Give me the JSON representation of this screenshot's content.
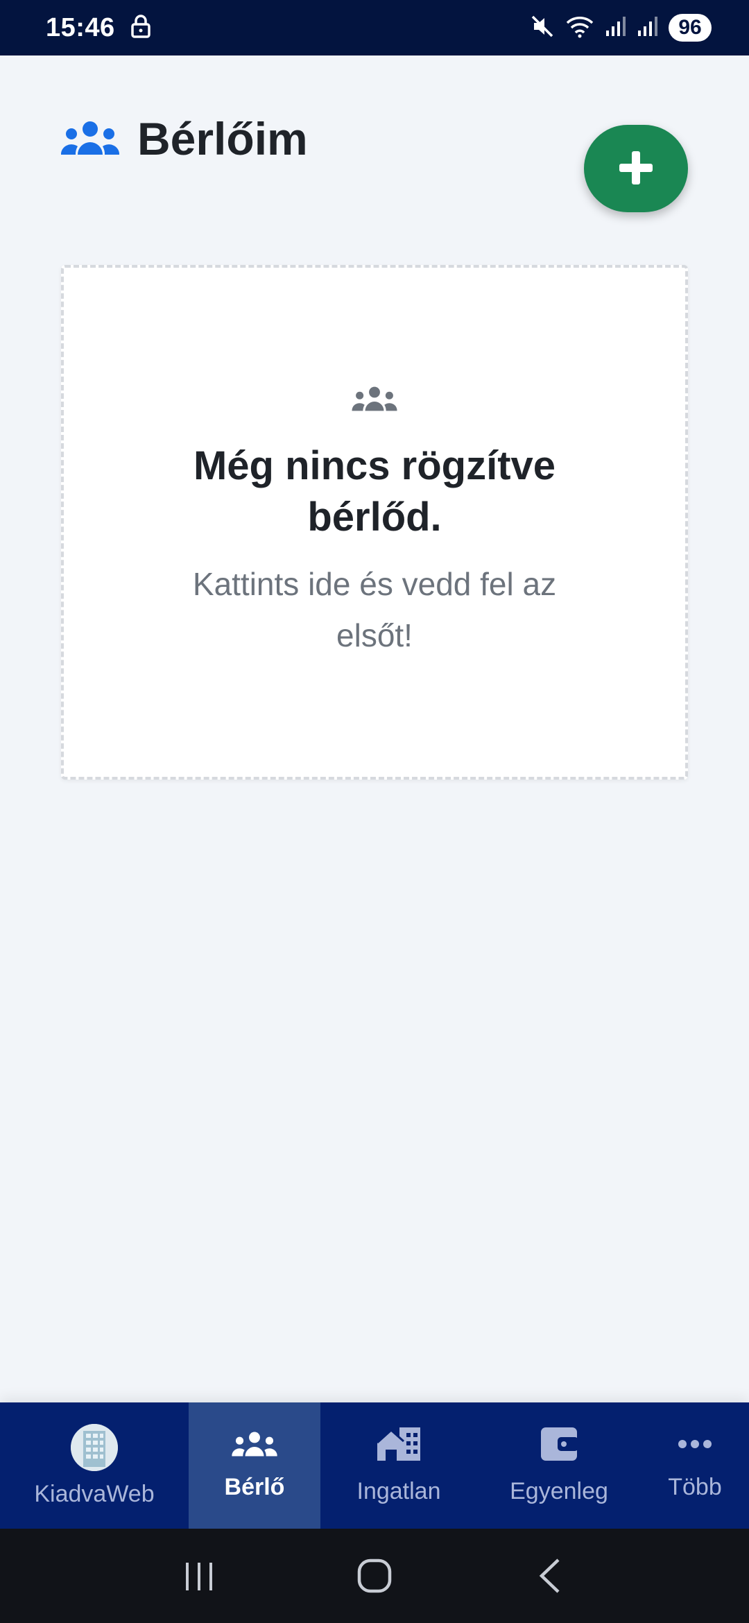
{
  "status_bar": {
    "time": "15:46",
    "battery": "96",
    "icons": [
      "lock-icon",
      "mute-icon",
      "wifi-icon",
      "signal-icon",
      "signal-icon"
    ]
  },
  "header": {
    "title": "Bérlőim",
    "title_icon": "users-icon",
    "add_button_icon": "plus-icon"
  },
  "empty_state": {
    "icon": "users-icon",
    "title": "Még nincs rögzítve bérlőd.",
    "subtitle": "Kattints ide és vedd fel az elsőt!"
  },
  "bottom_nav": {
    "items": [
      {
        "label": "KiadvaWeb",
        "icon": "app-logo-icon",
        "active": false
      },
      {
        "label": "Bérlő",
        "icon": "users-icon",
        "active": true
      },
      {
        "label": "Ingatlan",
        "icon": "building-icon",
        "active": false
      },
      {
        "label": "Egyenleg",
        "icon": "wallet-icon",
        "active": false
      },
      {
        "label": "Több",
        "icon": "more-icon",
        "active": false
      }
    ]
  },
  "colors": {
    "status_bar": "#03143f",
    "accent_blue": "#1a6fe6",
    "add_button": "#1a8753",
    "nav_bg": "#04206f",
    "nav_active": "#2a4a8a"
  }
}
